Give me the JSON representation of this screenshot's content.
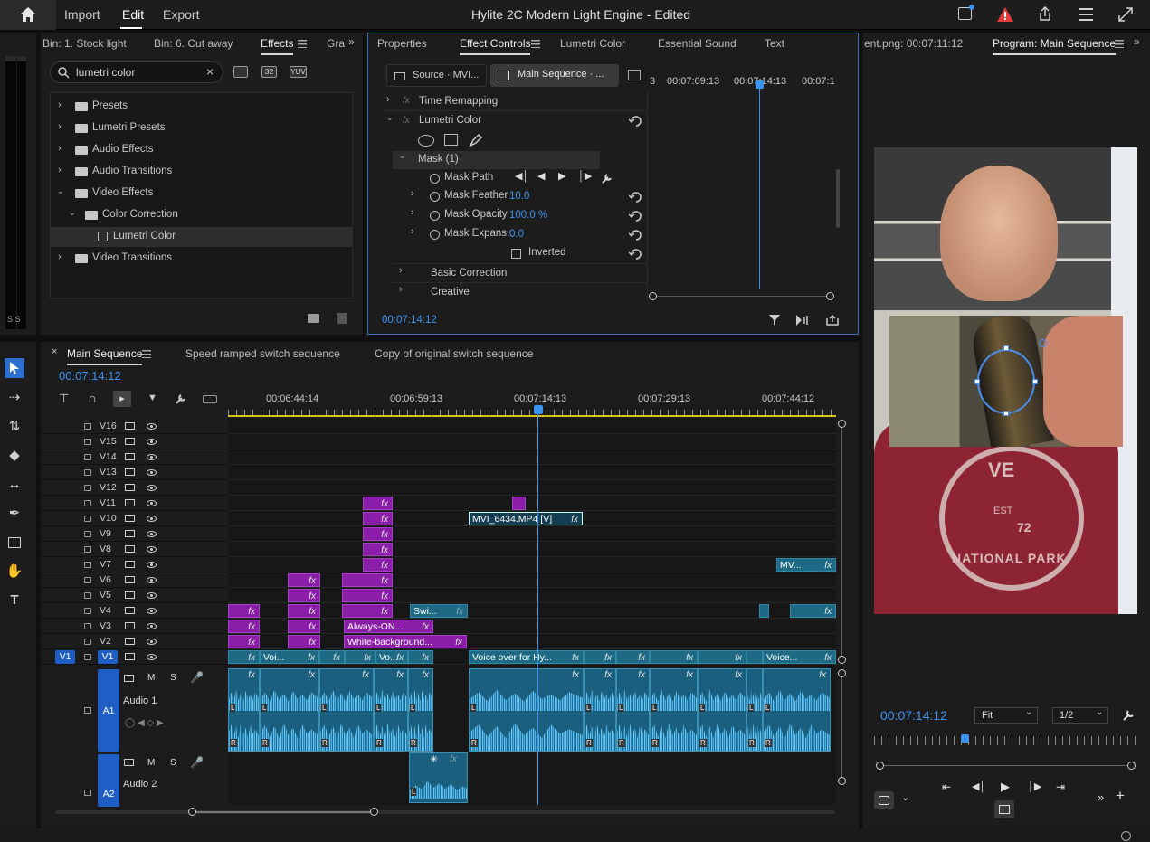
{
  "topbar": {
    "title": "Hylite 2C Modern Light Engine - Edited",
    "menus": [
      "Import",
      "Edit",
      "Export"
    ],
    "active_menu": "Edit"
  },
  "effects_panel": {
    "tabs": [
      "Bin: 1. Stock light",
      "Bin: 6. Cut away",
      "Effects",
      "Gra"
    ],
    "search_value": "lumetri color",
    "badges": [
      "32",
      "YUV"
    ],
    "items": [
      {
        "label": "Presets",
        "indent": 0,
        "expanded": false
      },
      {
        "label": "Lumetri Presets",
        "indent": 0,
        "expanded": false
      },
      {
        "label": "Audio Effects",
        "indent": 0,
        "expanded": false
      },
      {
        "label": "Audio Transitions",
        "indent": 0,
        "expanded": false
      },
      {
        "label": "Video Effects",
        "indent": 0,
        "expanded": true
      },
      {
        "label": "Color Correction",
        "indent": 1,
        "expanded": true
      },
      {
        "label": "Lumetri Color",
        "indent": 2,
        "selected": true
      },
      {
        "label": "Video Transitions",
        "indent": 0,
        "expanded": false
      }
    ]
  },
  "meter_label": "S S",
  "effect_controls": {
    "tabs": [
      "Properties",
      "Effect Controls",
      "Lumetri Color",
      "Essential Sound",
      "Text"
    ],
    "source_tab": "Source · MVI...",
    "sequence_tab": "Main Sequence · ...",
    "ruler": [
      "3",
      "00:07:09:13",
      "00:07:14:13",
      "00:07:1"
    ],
    "rows": {
      "time_remap": "Time Remapping",
      "lumetri": "Lumetri Color",
      "mask": "Mask (1)",
      "mask_path": "Mask Path",
      "mask_feather": "Mask Feather",
      "mask_feather_val": "10.0",
      "mask_opacity": "Mask Opacity",
      "mask_opacity_val": "100.0 %",
      "mask_expansion": "Mask Expans...",
      "mask_expansion_val": "0.0",
      "inverted": "Inverted",
      "basic": "Basic Correction",
      "creative": "Creative"
    },
    "timecode": "00:07:14:12"
  },
  "program": {
    "tab_left": "ent.png: 00:07:11:12",
    "tab_active": "Program: Main Sequence",
    "timecode": "00:07:14:12",
    "fit": "Fit",
    "res": "1/2",
    "frame_text": {
      "line1": "VE",
      "line2": "EST",
      "line3": "72",
      "line4": "NATIONAL PARK"
    }
  },
  "timeline": {
    "tabs": [
      "Main Sequence",
      "Speed ramped switch sequence",
      "Copy of original switch sequence"
    ],
    "timecode": "00:07:14:12",
    "ruler": [
      "00:06:44:14",
      "00:06:59:13",
      "00:07:14:13",
      "00:07:29:13",
      "00:07:44:12"
    ],
    "video_tracks": [
      "V16",
      "V15",
      "V14",
      "V13",
      "V12",
      "V11",
      "V10",
      "V9",
      "V8",
      "V7",
      "V6",
      "V5",
      "V4",
      "V3",
      "V2",
      "V1"
    ],
    "source_patch": "V1",
    "audio_tracks": [
      {
        "id": "A1",
        "name": "Audio 1"
      },
      {
        "id": "A2",
        "name": "Audio 2"
      }
    ],
    "clips": {
      "v10": "MVI_6434.MP4 [V]",
      "v7": "MV...",
      "v4": "Swi...",
      "v3": "Always-ON...",
      "v2": "White-background...",
      "v1a": "Voi...",
      "v1b": "Vo...",
      "v1c": "Voice over for Hy...",
      "v1d": "Voice...",
      "fx": "fx",
      "m": "M",
      "s": "S",
      "l": "L",
      "r": "R"
    }
  }
}
